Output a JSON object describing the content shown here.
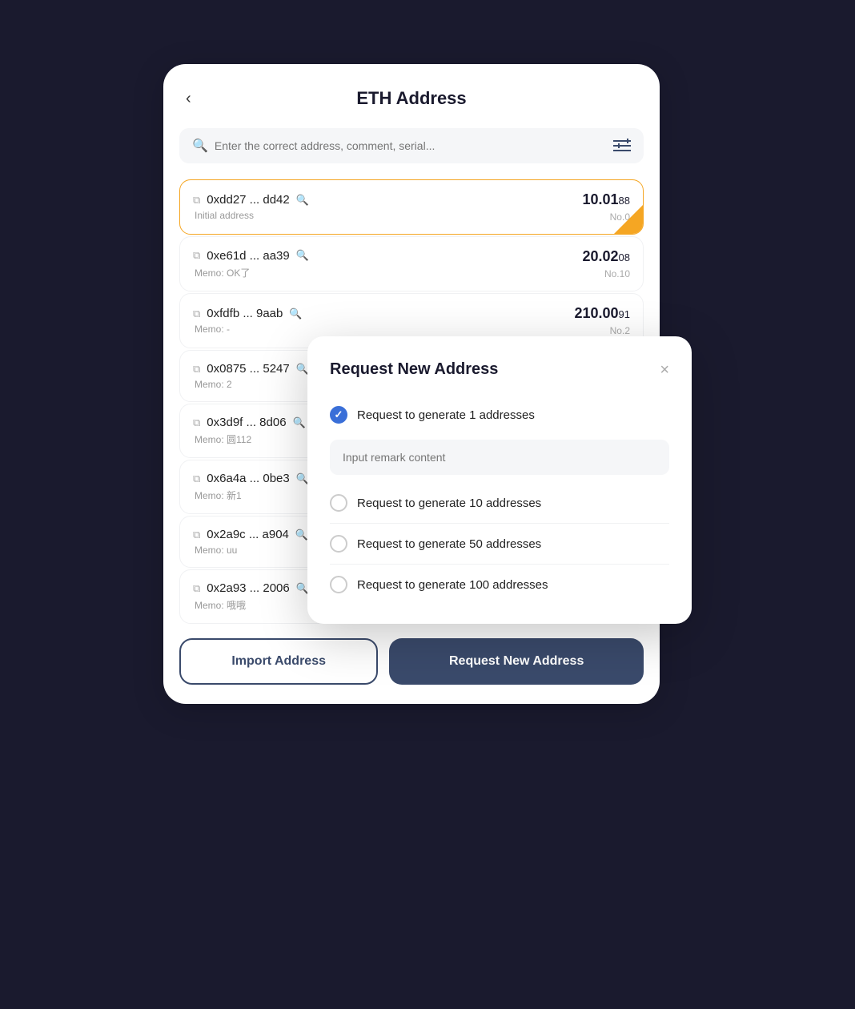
{
  "header": {
    "back_label": "‹",
    "title": "ETH Address"
  },
  "search": {
    "placeholder": "Enter the correct address, comment, serial...",
    "filter_icon": "≡↕"
  },
  "addresses": [
    {
      "address": "0xdd27 ... dd42",
      "memo": "Initial address",
      "amount_int": "10.01",
      "amount_dec": "88",
      "serial": "No.0",
      "active": true
    },
    {
      "address": "0xe61d ... aa39",
      "memo": "Memo: OK了",
      "amount_int": "20.02",
      "amount_dec": "08",
      "serial": "No.10",
      "active": false
    },
    {
      "address": "0xfdfb ... 9aab",
      "memo": "Memo: -",
      "amount_int": "210.00",
      "amount_dec": "91",
      "serial": "No.2",
      "active": false
    },
    {
      "address": "0x0875 ... 5247",
      "memo": "Memo: 2",
      "amount_int": "",
      "amount_dec": "",
      "serial": "",
      "active": false
    },
    {
      "address": "0x3d9f ... 8d06",
      "memo": "Memo: 圆112",
      "amount_int": "",
      "amount_dec": "",
      "serial": "",
      "active": false
    },
    {
      "address": "0x6a4a ... 0be3",
      "memo": "Memo: 新1",
      "amount_int": "",
      "amount_dec": "",
      "serial": "",
      "active": false
    },
    {
      "address": "0x2a9c ... a904",
      "memo": "Memo: uu",
      "amount_int": "",
      "amount_dec": "",
      "serial": "",
      "active": false
    },
    {
      "address": "0x2a93 ... 2006",
      "memo": "Memo: 哦哦",
      "amount_int": "",
      "amount_dec": "",
      "serial": "",
      "active": false
    }
  ],
  "bottom": {
    "import_label": "Import Address",
    "request_label": "Request New Address"
  },
  "modal": {
    "title": "Request New Address",
    "close_icon": "×",
    "options": [
      {
        "label": "Request to generate 1 addresses",
        "checked": true
      },
      {
        "label": "Request to generate 10 addresses",
        "checked": false
      },
      {
        "label": "Request to generate 50 addresses",
        "checked": false
      },
      {
        "label": "Request to generate 100 addresses",
        "checked": false
      }
    ],
    "remark_placeholder": "Input remark content"
  }
}
